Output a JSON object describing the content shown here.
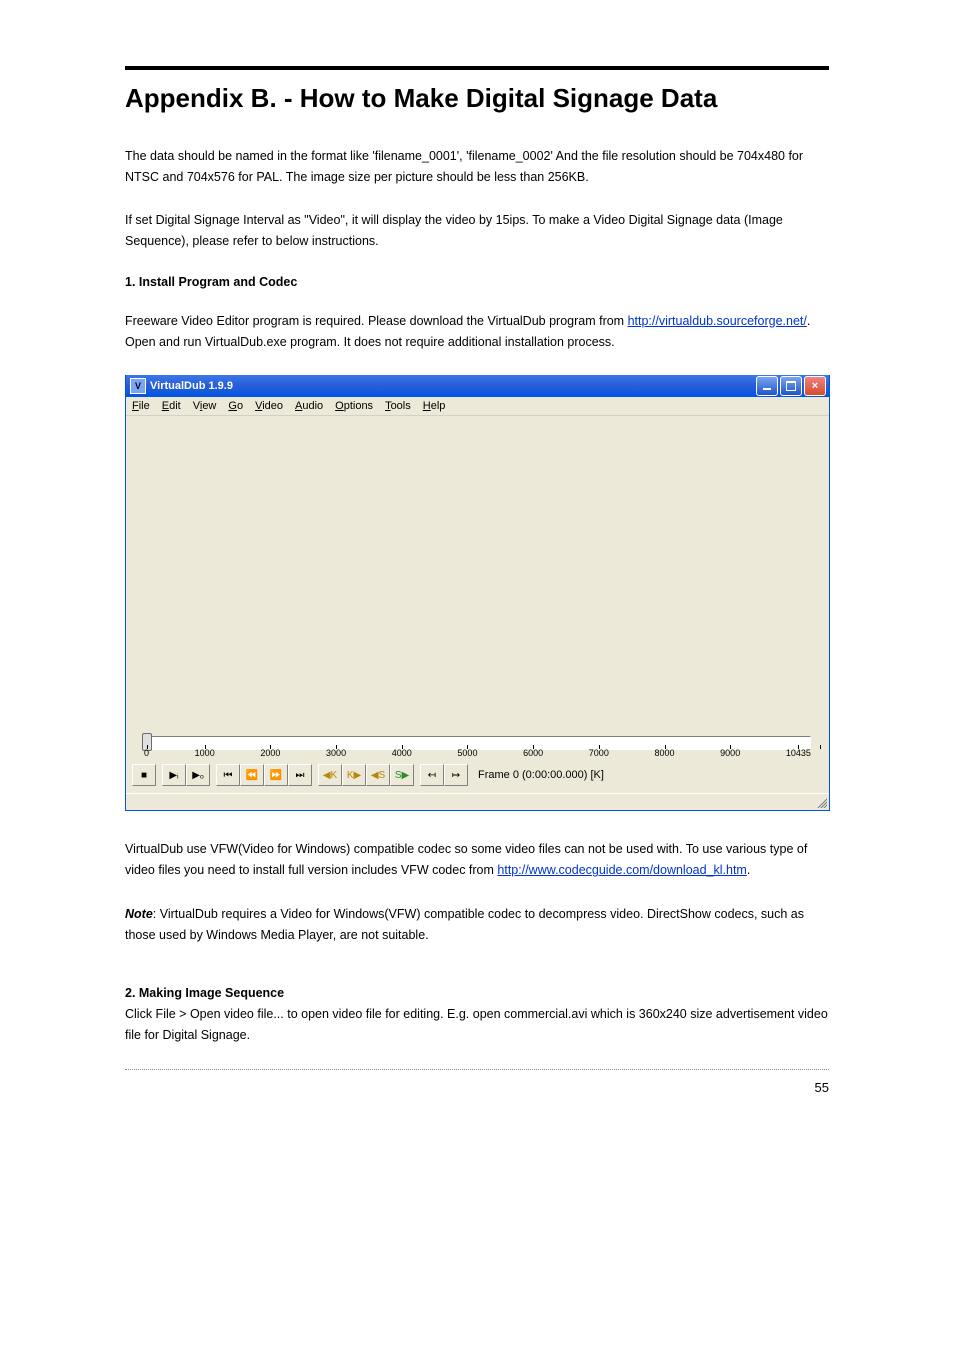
{
  "heading": "Appendix B. - How to Make Digital Signage Data",
  "para1": "The data should be named in the format like 'filename_0001', 'filename_0002'\nAnd the file resolution should be 704x480 for NTSC and 704x576 for PAL. The image size per picture should be less than 256KB.",
  "para2": "If set Digital Signage Interval as \"Video\", it will display the video by 15ips. To make a Video Digital Signage data (Image Sequence), please refer to below instructions.",
  "section1_title": "1. Install Program and Codec",
  "section1_text_pre": "Freeware Video Editor program is required. Please download the VirtualDub program from ",
  "section1_link1": "http://virtualdub.sourceforge.net/",
  "section1_text_post": ". Open and run VirtualDub.exe program. It does not require additional installation process.",
  "vd": {
    "title": "VirtualDub 1.9.9",
    "menus": [
      "File",
      "Edit",
      "View",
      "Go",
      "Video",
      "Audio",
      "Options",
      "Tools",
      "Help"
    ],
    "ticks": [
      "0",
      "1000",
      "2000",
      "3000",
      "4000",
      "5000",
      "6000",
      "7000",
      "8000",
      "9000",
      "10435"
    ],
    "frame_label": "Frame 0 (0:00:00.000) [K]"
  },
  "para3_pre": "VirtualDub use VFW(Video for Windows) compatible codec so some video files can not be used with. To use various type of video files you need to install full version includes VFW codec from ",
  "para3_link": "http://www.codecguide.com/download_kl.htm",
  "para3_post": ".",
  "note_label": "Note",
  "note_text": ": VirtualDub requires a Video for Windows(VFW) compatible codec to decompress video. DirectShow codecs, such as those used by Windows Media Player, are not suitable.",
  "section2_title": "2. Making Image Sequence",
  "section2_text": "Click File > Open video file... to open video file for editing. E.g. open commercial.avi which is 360x240 size advertisement video file for Digital Signage.",
  "page_number": "55"
}
